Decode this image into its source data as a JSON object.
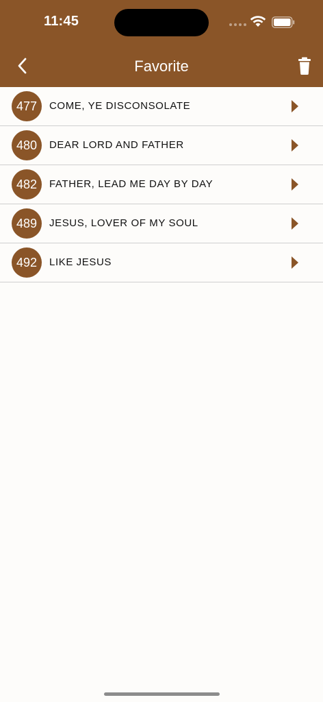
{
  "status_bar": {
    "time": "11:45"
  },
  "header": {
    "title": "Favorite"
  },
  "colors": {
    "brand": "#8a5528",
    "background": "#fdfcfa"
  },
  "icons": {
    "back": "chevron-left-icon",
    "delete": "trash-icon",
    "row_action": "play-triangle-icon"
  },
  "favorites": [
    {
      "number": "477",
      "title": "COME, YE DISCONSOLATE"
    },
    {
      "number": "480",
      "title": "DEAR LORD AND FATHER"
    },
    {
      "number": "482",
      "title": "FATHER, LEAD ME DAY BY DAY"
    },
    {
      "number": "489",
      "title": "JESUS, LOVER OF MY SOUL"
    },
    {
      "number": "492",
      "title": "LIKE JESUS"
    }
  ]
}
